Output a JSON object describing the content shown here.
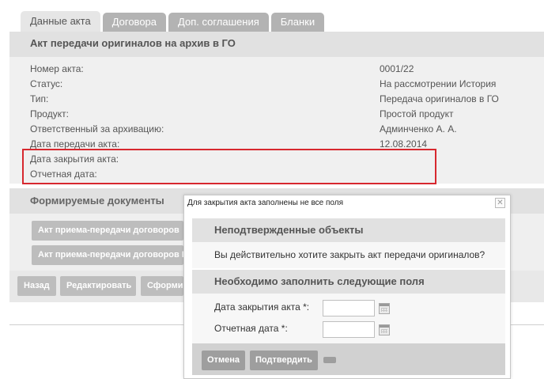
{
  "tabs": [
    "Данные акта",
    "Договора",
    "Доп. соглашения",
    "Бланки"
  ],
  "act": {
    "title": "Акт передачи оригиналов на архив в ГО",
    "fields": [
      {
        "label": "Номер акта:",
        "value": "0001/22"
      },
      {
        "label": "Статус:",
        "value": "На рассмотрении История"
      },
      {
        "label": "Тип:",
        "value": "Передача оригиналов в ГО"
      },
      {
        "label": "Продукт:",
        "value": "Простой продукт"
      },
      {
        "label": "Ответственный за архивацию:",
        "value": "Админченко А. А."
      },
      {
        "label": "Дата передачи акта:",
        "value": "12.08.2014"
      },
      {
        "label": "Дата закрытия акта:",
        "value": ""
      },
      {
        "label": "Отчетная дата:",
        "value": ""
      }
    ]
  },
  "docs": {
    "title": "Формируемые документы",
    "buttons": [
      "Акт приема-передачи договоров",
      "Акт приема-передачи договоров КИ"
    ]
  },
  "actions": [
    "Назад",
    "Редактировать",
    "Сформировать"
  ],
  "dialog": {
    "title": "Для закрытия акта заполнены не все поля",
    "section1_title": "Неподтвержденные объекты",
    "section1_text": "Вы действительно хотите закрыть акт передачи оригиналов?",
    "section2_title": "Необходимо заполнить следующие поля",
    "field1_label": "Дата закрытия акта *:",
    "field1_value": "",
    "field2_label": "Отчетная дата *:",
    "field2_value": "",
    "cancel_label": "Отмена",
    "confirm_label": "Подтвердить"
  },
  "colors": {
    "highlight_border": "#d7282f"
  }
}
